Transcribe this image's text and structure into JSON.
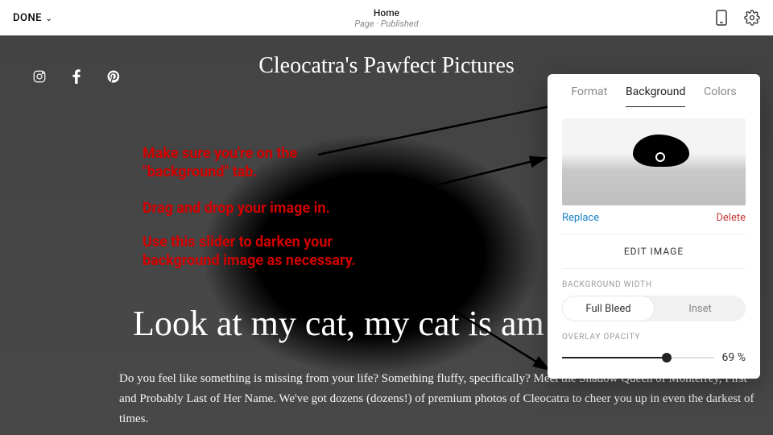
{
  "topbar": {
    "done_label": "DONE",
    "page_name": "Home",
    "page_status": "Page · Published"
  },
  "site": {
    "title": "Cleocatra's Pawfect Pictures",
    "hero_heading": "Look at my cat, my cat is am",
    "hero_body": "Do you feel like something is missing from your life? Something fluffy, specifically? Meet the Shadow Queen of Monterrey, First and Probably Last of Her Name. We've got dozens (dozens!) of premium photos of Cleocatra to cheer you up in even the darkest of times."
  },
  "annotations": {
    "line1": "Make sure you're on the \"background\" tab.",
    "line2": "Drag and drop your image in.",
    "line3": "Use this slider to darken your background image as necessary."
  },
  "panel": {
    "tabs": {
      "format": "Format",
      "background": "Background",
      "colors": "Colors"
    },
    "replace": "Replace",
    "delete": "Delete",
    "edit_image": "EDIT IMAGE",
    "bg_width_label": "BACKGROUND WIDTH",
    "seg": {
      "full_bleed": "Full Bleed",
      "inset": "Inset"
    },
    "opacity_label": "OVERLAY OPACITY",
    "opacity_value": "69 %"
  }
}
